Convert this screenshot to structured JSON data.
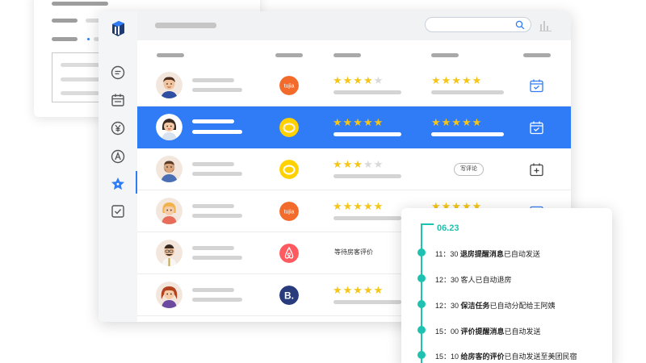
{
  "colors": {
    "accent": "#2f7cf6",
    "star": "#f5c518",
    "teal": "#1fc2b0"
  },
  "sidebar": {
    "icons": [
      "chat-icon",
      "calendar-icon",
      "yen-icon",
      "a-circle-icon",
      "star-icon",
      "checkbox-icon"
    ]
  },
  "rows": [
    {
      "platform": "tujia",
      "platform_label": "tujia",
      "rating1": 4,
      "rating2": 5,
      "action": "calendar-check-icon"
    },
    {
      "platform": "meituan",
      "platform_label": "",
      "rating1": 5,
      "rating2": 5,
      "action": "calendar-check-icon"
    },
    {
      "platform": "meituan",
      "platform_label": "",
      "rating1": 3,
      "review_button": "写评论",
      "action": "calendar-plus-icon"
    },
    {
      "platform": "tujia",
      "platform_label": "tujia",
      "rating1": 5,
      "rating2": 5,
      "action": "calendar-icon"
    },
    {
      "platform": "airbnb",
      "platform_label": "",
      "status": "等待房客评价",
      "action": ""
    },
    {
      "platform": "booking",
      "platform_label": "B.",
      "rating1": 5,
      "action": ""
    }
  ],
  "timeline": {
    "date": "06.23",
    "items": [
      {
        "time": "11：30",
        "bold": "退房提醒消息",
        "text": "已自动发送"
      },
      {
        "time": "12：30",
        "bold": "",
        "text": "客人已自动退房"
      },
      {
        "time": "12：30",
        "bold": "保洁任务",
        "text": "已自动分配给王阿姨"
      },
      {
        "time": "15：00",
        "bold": "评价提醒消息",
        "text": "已自动发送"
      },
      {
        "time": "15：10",
        "bold": "给房客的评价",
        "text": "已自动发送至美团民宿"
      }
    ]
  }
}
